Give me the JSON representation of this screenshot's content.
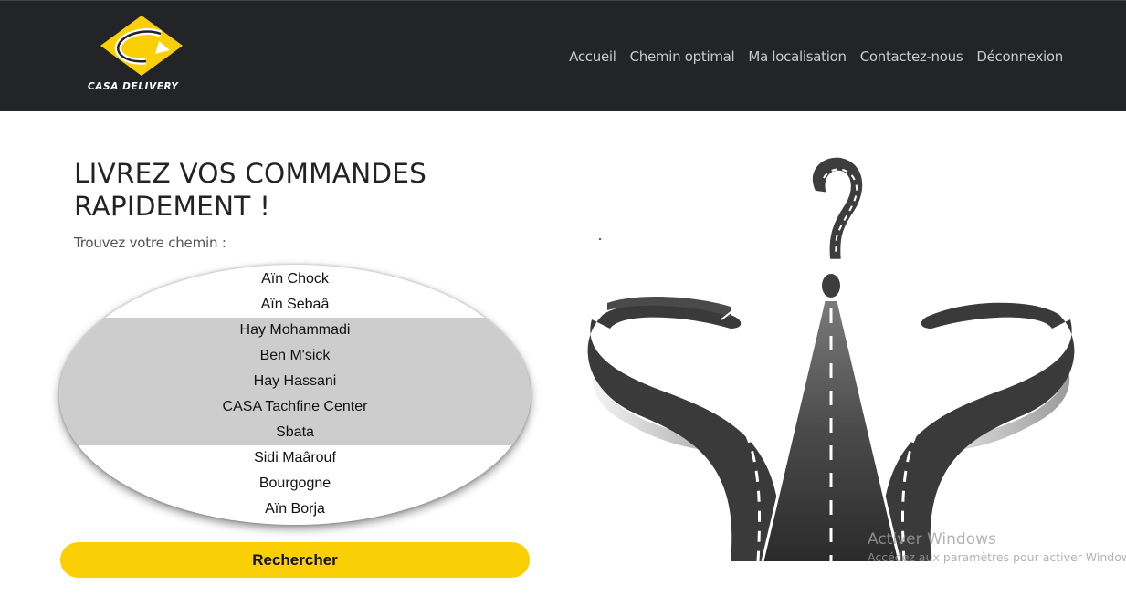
{
  "brand": {
    "name": "CASA DELIVERY",
    "accent": "#fbcf05",
    "navbar_bg": "#222428"
  },
  "nav": {
    "items": [
      {
        "label": "Accueil"
      },
      {
        "label": "Chemin optimal"
      },
      {
        "label": "Ma localisation"
      },
      {
        "label": "Contactez-nous"
      },
      {
        "label": "Déconnexion"
      }
    ]
  },
  "hero": {
    "title": "LIVREZ VOS COMMANDES RAPIDEMENT !",
    "subtitle": "Trouvez votre chemin :"
  },
  "locations": {
    "options": [
      {
        "label": "Aïn Chock",
        "highlighted": false
      },
      {
        "label": "Aïn Sebaâ",
        "highlighted": false
      },
      {
        "label": "Hay Mohammadi",
        "highlighted": true
      },
      {
        "label": "Ben M'sick",
        "highlighted": true
      },
      {
        "label": "Hay Hassani",
        "highlighted": true
      },
      {
        "label": "CASA Tachfine Center",
        "highlighted": true
      },
      {
        "label": "Sbata",
        "highlighted": true
      },
      {
        "label": "Sidi Maârouf",
        "highlighted": false
      },
      {
        "label": "Bourgogne",
        "highlighted": false
      },
      {
        "label": "Aïn Borja",
        "highlighted": false
      }
    ]
  },
  "search_button": {
    "label": "Rechercher"
  },
  "illustration": {
    "icon": "crossroads-question-mark-road"
  },
  "windows_watermark": {
    "title": "Activer Windows",
    "subtitle": "Accédez aux paramètres pour activer Windows."
  }
}
